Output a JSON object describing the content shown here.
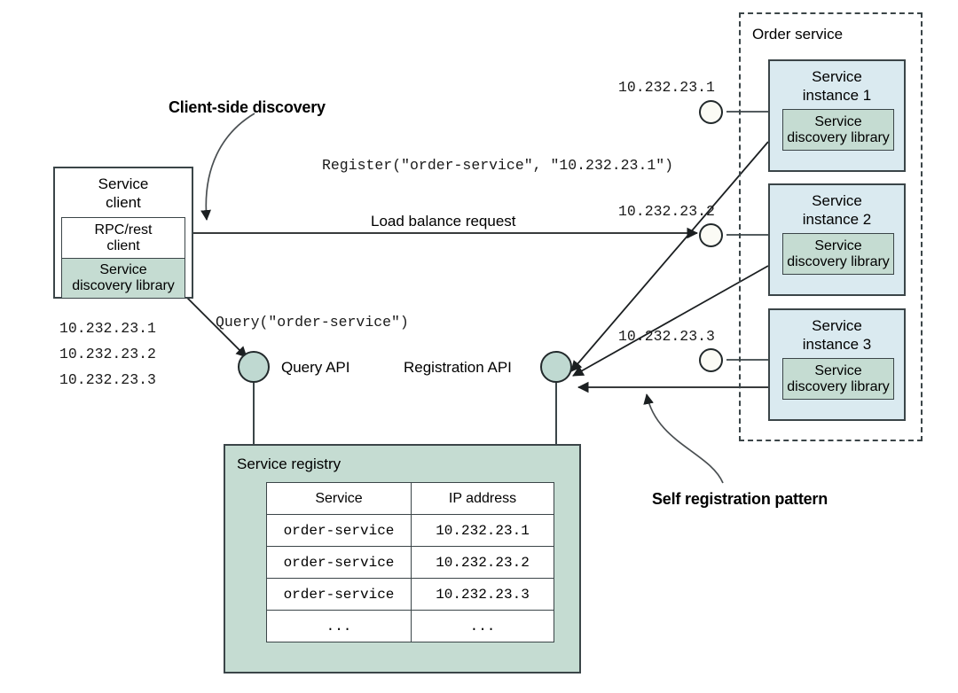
{
  "diagram": {
    "annotations": {
      "client_side_discovery": "Client-side discovery",
      "self_registration": "Self registration pattern"
    },
    "service_client": {
      "title_line1": "Service",
      "title_line2": "client",
      "rpc_line1": "RPC/rest",
      "rpc_line2": "client",
      "sdl_line1": "Service",
      "sdl_line2": "discovery library"
    },
    "client_ip_list": [
      "10.232.23.1",
      "10.232.23.2",
      "10.232.23.3"
    ],
    "calls": {
      "register": "Register(\"order-service\", \"10.232.23.1\")",
      "query": "Query(\"order-service\")",
      "load_balance": "Load balance request"
    },
    "api_nodes": {
      "query_api": "Query API",
      "registration_api": "Registration API"
    },
    "order_service": {
      "title": "Order service",
      "instances": [
        {
          "title_line1": "Service",
          "title_line2": "instance 1",
          "sdl_line1": "Service",
          "sdl_line2": "discovery library",
          "ip": "10.232.23.1"
        },
        {
          "title_line1": "Service",
          "title_line2": "instance 2",
          "sdl_line1": "Service",
          "sdl_line2": "discovery library",
          "ip": "10.232.23.2"
        },
        {
          "title_line1": "Service",
          "title_line2": "instance 3",
          "sdl_line1": "Service",
          "sdl_line2": "discovery library",
          "ip": "10.232.23.3"
        }
      ]
    },
    "registry": {
      "title": "Service registry",
      "columns": [
        "Service",
        "IP address"
      ],
      "rows": [
        {
          "service": "order-service",
          "ip": "10.232.23.1"
        },
        {
          "service": "order-service",
          "ip": "10.232.23.2"
        },
        {
          "service": "order-service",
          "ip": "10.232.23.3"
        },
        {
          "service": "...",
          "ip": "..."
        }
      ]
    },
    "colors": {
      "instance_fill": "#daeaf0",
      "library_fill": "#c5dcd2",
      "registry_fill": "#c5dcd2",
      "node_fill": "#bfd9d1",
      "stroke": "#3b4548"
    }
  }
}
